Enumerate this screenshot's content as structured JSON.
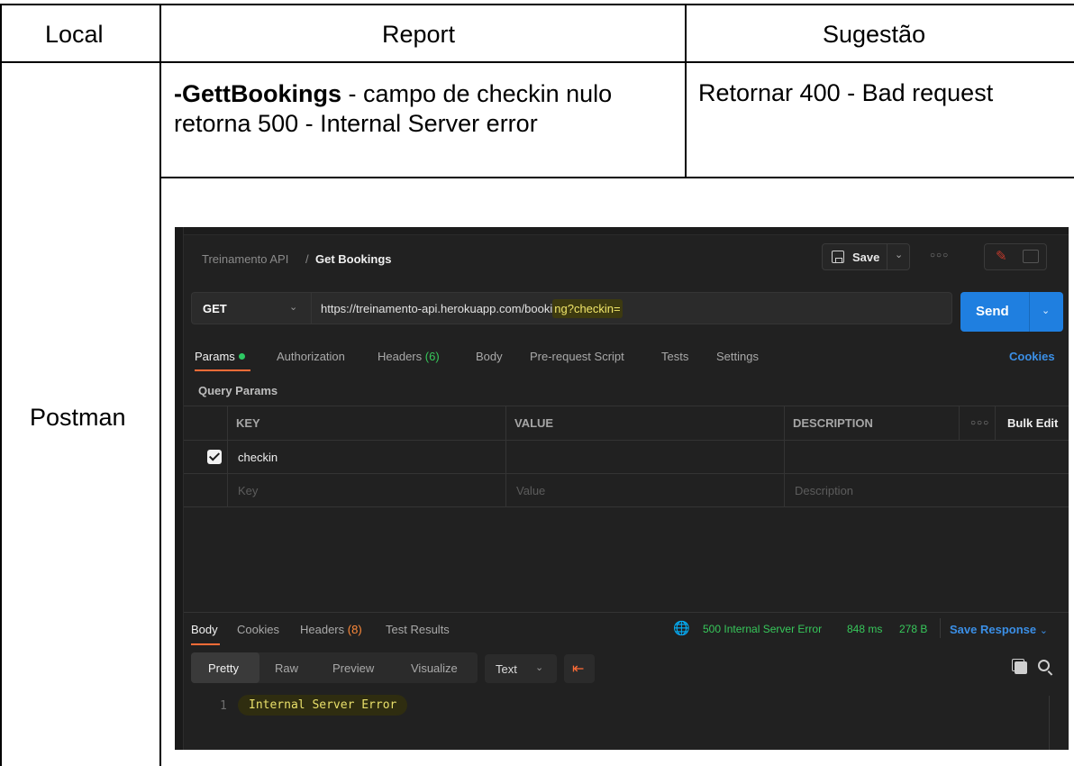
{
  "table": {
    "headers": {
      "local": "Local",
      "report": "Report",
      "suggestion": "Sugestão"
    },
    "row": {
      "local": "Postman",
      "report_bold": "-GettBookings",
      "report_line1_rest": " - campo de checkin nulo",
      "report_line2": "retorna 500 - Internal Server error",
      "suggestion": "Retornar 400 - Bad request"
    }
  },
  "postman": {
    "breadcrumb": {
      "parent": "Treinamento API",
      "separator": "/",
      "current": "Get Bookings"
    },
    "save_label": "Save",
    "request": {
      "method": "GET",
      "url_base": "https://treinamento-api.herokuapp.com/booki",
      "url_highlight": "ng?checkin=",
      "send_label": "Send"
    },
    "request_tabs": {
      "params": "Params",
      "authorization": "Authorization",
      "headers": "Headers",
      "headers_count": "(6)",
      "body": "Body",
      "prerequest": "Pre-request Script",
      "tests": "Tests",
      "settings": "Settings",
      "cookies": "Cookies"
    },
    "query_params": {
      "title": "Query Params",
      "columns": {
        "key": "KEY",
        "value": "VALUE",
        "description": "DESCRIPTION"
      },
      "bulk_edit": "Bulk Edit",
      "rows": [
        {
          "key": "checkin",
          "checked": true
        }
      ],
      "placeholders": {
        "key": "Key",
        "value": "Value",
        "description": "Description"
      }
    },
    "response_tabs": {
      "body": "Body",
      "cookies": "Cookies",
      "headers": "Headers",
      "headers_count": "(8)",
      "test_results": "Test Results"
    },
    "status": {
      "text": "500 Internal Server Error",
      "time": "848 ms",
      "size": "278 B",
      "save_response": "Save Response"
    },
    "view_modes": {
      "pretty": "Pretty",
      "raw": "Raw",
      "preview": "Preview",
      "visualize": "Visualize"
    },
    "format": "Text",
    "code": {
      "line_number": "1",
      "text": "Internal Server Error"
    },
    "colors": {
      "accent_orange": "#ff6c37",
      "send_blue": "#1f7fe0",
      "status_green": "#37c85b",
      "highlight_yellow": "#f1e66a"
    }
  }
}
